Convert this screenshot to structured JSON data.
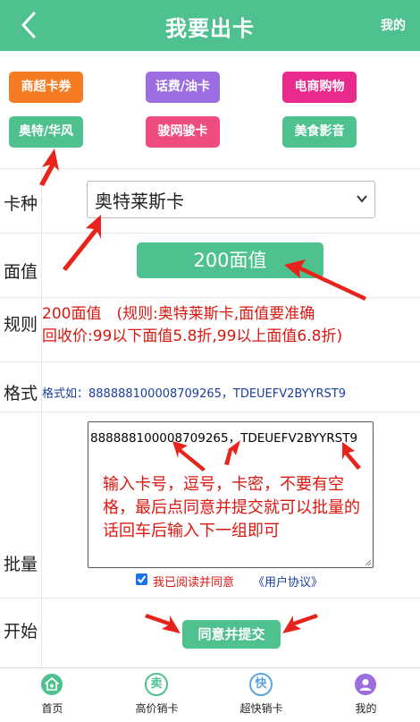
{
  "header": {
    "title": "我要出卡",
    "mine_label": "我的"
  },
  "colors": {
    "primary": "#4ec18f",
    "red": "#d9170f",
    "blue": "#1a3e9c"
  },
  "categories": [
    {
      "label": "商超卡券",
      "color": "#f57c22"
    },
    {
      "label": "话费/油卡",
      "color": "#9b6de0"
    },
    {
      "label": "电商购物",
      "color": "#e82a8c"
    },
    {
      "label": "奥特/华风",
      "color": "#4ec18f"
    },
    {
      "label": "骏网骏卡",
      "color": "#ee4b7e"
    },
    {
      "label": "美食影音",
      "color": "#4ec18f"
    }
  ],
  "form": {
    "card_type": {
      "label": "卡种",
      "value": "奥特莱斯卡"
    },
    "face_value": {
      "label": "面值",
      "value": "200面值"
    },
    "rules": {
      "label": "规则",
      "line1": "200面值　(规则:奥特莱斯卡,面值要准确",
      "line2": "回收价:99以下面值5.8折,99以上面值6.8折)"
    },
    "format": {
      "label": "格式",
      "text": "格式如：888888100008709265，TDEUEFV2BYYRST9"
    },
    "batch": {
      "label": "批量",
      "value": "888888100008709265，TDEUEFV2BYYRST9",
      "tip": "输入卡号，逗号，卡密，不要有空格，最后点同意并提交就可以批量的话回车后输入下一组即可"
    },
    "agreement": {
      "text": "我已阅读并同意",
      "link": "《用户协议》",
      "checked": true
    },
    "start": {
      "label": "开始",
      "submit_label": "同意并提交"
    }
  },
  "nav": [
    {
      "label": "首页",
      "icon": "home-icon",
      "color": "#4ec18f"
    },
    {
      "label": "高价销卡",
      "icon": "sell-icon",
      "color": "#4ec18f",
      "glyph": "卖"
    },
    {
      "label": "超快销卡",
      "icon": "fast-icon",
      "color": "#5aa6e0",
      "glyph": "快"
    },
    {
      "label": "我的",
      "icon": "profile-icon",
      "color": "#9b6de0"
    }
  ]
}
